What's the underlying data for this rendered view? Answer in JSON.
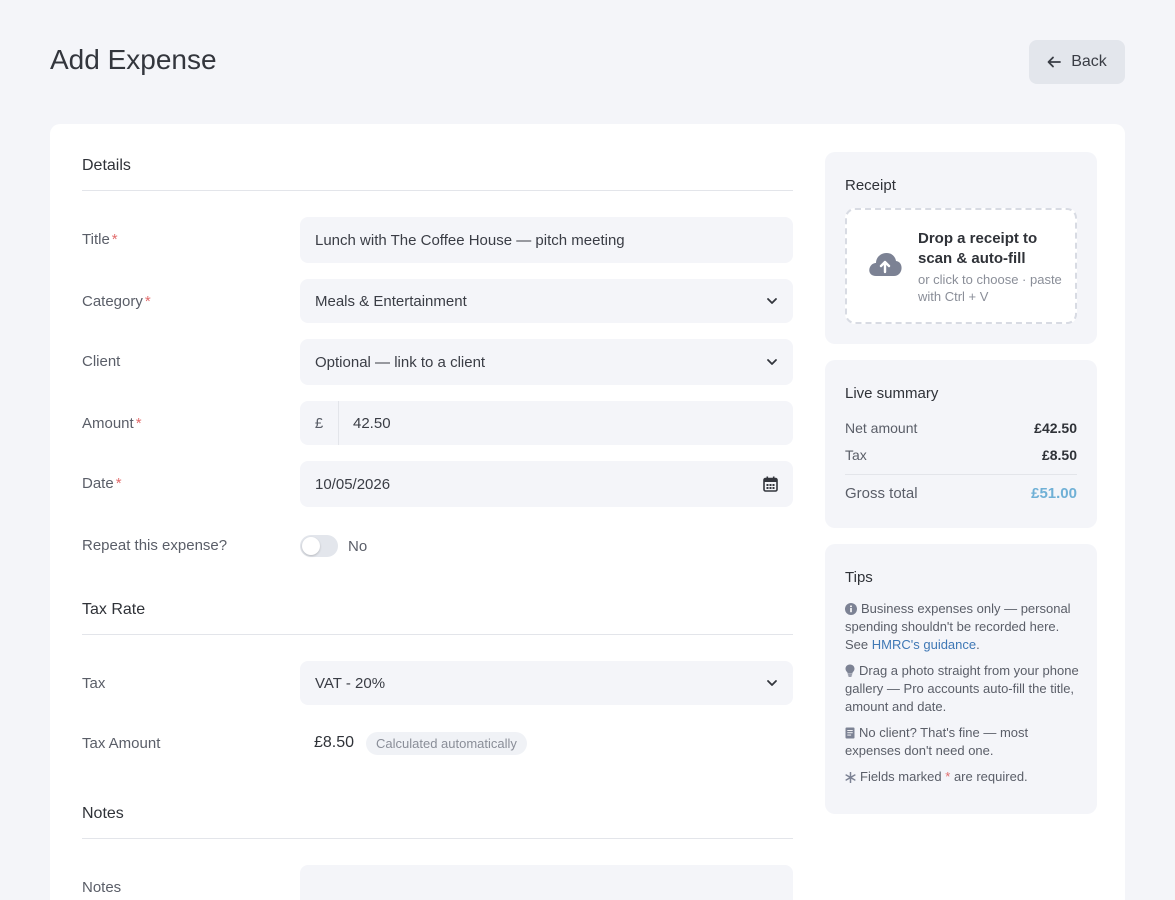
{
  "page": {
    "title": "Add Expense",
    "back_label": "Back"
  },
  "details": {
    "heading": "Details",
    "title_label": "Title",
    "title_value": "Lunch with The Coffee House — pitch meeting",
    "category_label": "Category",
    "category_value": "Meals & Entertainment",
    "client_label": "Client",
    "client_placeholder": "Optional — link to a client",
    "amount_label": "Amount",
    "currency": "£",
    "amount_value": "42.50",
    "date_label": "Date",
    "date_value": "10/05/2026",
    "repeat_label": "Repeat this expense?",
    "repeat_state": "No",
    "required_mark": "*"
  },
  "tax": {
    "heading": "Tax Rate",
    "tax_label": "Tax",
    "tax_value": "VAT - 20%",
    "tax_amount_label": "Tax Amount",
    "tax_amount_value": "£8.50",
    "auto_badge": "Calculated automatically"
  },
  "notes": {
    "heading": "Notes",
    "label": "Notes"
  },
  "receipt": {
    "title": "Receipt",
    "drop_title": "Drop a receipt to scan & auto-fill",
    "drop_sub": "or click to choose · paste with Ctrl + V",
    "icon": "cloud-upload-icon"
  },
  "summary": {
    "title": "Live summary",
    "net_label": "Net amount",
    "net_value": "£42.50",
    "tax_label": "Tax",
    "tax_value": "£8.50",
    "gross_label": "Gross total",
    "gross_value": "£51.00"
  },
  "tips": {
    "title": "Tips",
    "tip1_text": "Business expenses only — personal spending shouldn't be recorded here. See",
    "tip1_link": "HMRC's guidance",
    "tip1_end": ".",
    "tip2": "Drag a photo straight from your phone gallery — Pro accounts auto-fill the title, amount and date.",
    "tip3": "No client? That's fine — most expenses don't need one.",
    "tip4_pre": "Fields marked",
    "tip4_mark": "*",
    "tip4_post": "are required."
  },
  "colors": {
    "accent": "#6fb0d6",
    "required": "#e26c6c",
    "link": "#3f78b5",
    "background": "#f4f5f9"
  }
}
